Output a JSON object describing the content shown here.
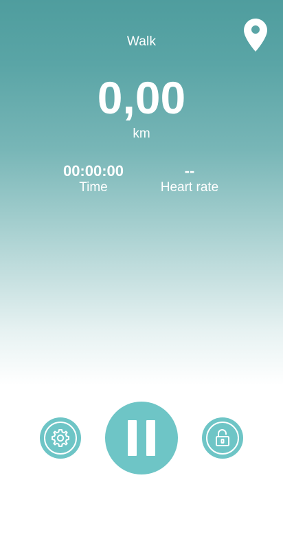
{
  "activity": {
    "type_label": "Walk"
  },
  "distance": {
    "value": "0,00",
    "unit": "km"
  },
  "stats": {
    "time": {
      "value": "00:00:00",
      "label": "Time"
    },
    "heart_rate": {
      "value": "--",
      "label": "Heart rate"
    }
  },
  "icons": {
    "location": "map-pin-icon",
    "settings": "gear-icon",
    "pause": "pause-icon",
    "lock": "unlocked-padlock-icon"
  },
  "colors": {
    "accent": "#6ec5c6",
    "gradient_top": "#4f9d9e",
    "text": "#ffffff"
  }
}
